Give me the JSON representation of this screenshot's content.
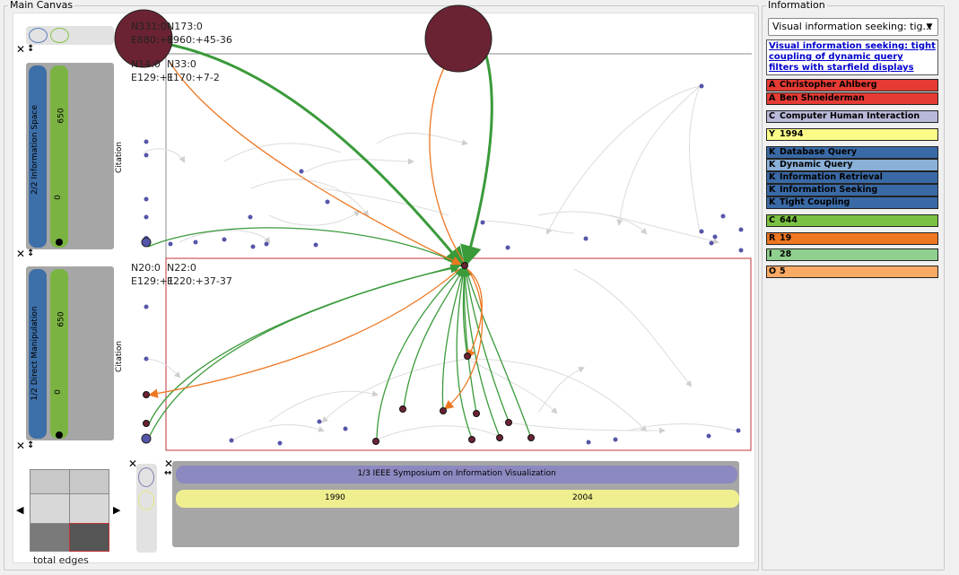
{
  "main_canvas": {
    "title": "Main Canvas",
    "top_graph": {
      "nodes_label_a": "N331:0",
      "nodes_label_b": "N173:0",
      "edges_label_a": "E880:+1",
      "edges_label_b": "E960:+45-36",
      "sub_nodes_a": "N14:0",
      "sub_nodes_b": "N33:0",
      "sub_edges_a": "E129:+1",
      "sub_edges_b": "E170:+7-2",
      "relation_label": "Citation"
    },
    "bottom_graph": {
      "nodes_label_a": "N20:0",
      "nodes_label_b": "N22:0",
      "edges_label_a": "E129:+1",
      "edges_label_b": "E220:+37-37",
      "relation_label": "Citation"
    },
    "facet_top": {
      "label": "2/2 Information Space",
      "max_value": "650",
      "min_value": "0"
    },
    "facet_bottom": {
      "label": "1/2 Direct Manipulation",
      "max_value": "650",
      "min_value": "0"
    },
    "timeline": {
      "venue_label": "1/3 IEEE Symposium on Information Visualization",
      "start_year": "1990",
      "end_year": "2004"
    },
    "minimap_label": "total edges",
    "colors": {
      "citation_in": "#3a9a3a",
      "citation_out": "#ee7722",
      "node": "#5555aa",
      "hub_node": "#6b2333",
      "selection_border": "#c0333b"
    }
  },
  "information": {
    "title": "Information",
    "selected_paper": "Visual information seeking: tig...",
    "paper_title": "Visual information seeking: tight coupling of dynamic query filters with starfield displays",
    "attributes": [
      {
        "prefix": "A",
        "value": "Christopher Ahlberg",
        "color": "#e53b34"
      },
      {
        "prefix": "A",
        "value": "Ben Shneiderman",
        "color": "#e53b34"
      },
      {
        "prefix": "C",
        "value": "Computer Human Interaction",
        "color": "#b9b9d9"
      },
      {
        "prefix": "Y",
        "value": "1994",
        "color": "#fbfb88"
      },
      {
        "prefix": "K",
        "value": "Database Query",
        "color": "#3a6aa6"
      },
      {
        "prefix": "K",
        "value": "Dynamic Query",
        "color": "#8ab0d8"
      },
      {
        "prefix": "K",
        "value": "Information Retrieval",
        "color": "#3a6aa6"
      },
      {
        "prefix": "K",
        "value": "Information Seeking",
        "color": "#3a6aa6"
      },
      {
        "prefix": "K",
        "value": "Tight Coupling",
        "color": "#3a6aa6"
      },
      {
        "prefix": "C",
        "value": "644",
        "color": "#7bc143"
      },
      {
        "prefix": "R",
        "value": "19",
        "color": "#ee7722"
      },
      {
        "prefix": "I",
        "value": "28",
        "color": "#8fd08f"
      },
      {
        "prefix": "O",
        "value": "5",
        "color": "#fbaa66"
      }
    ]
  }
}
